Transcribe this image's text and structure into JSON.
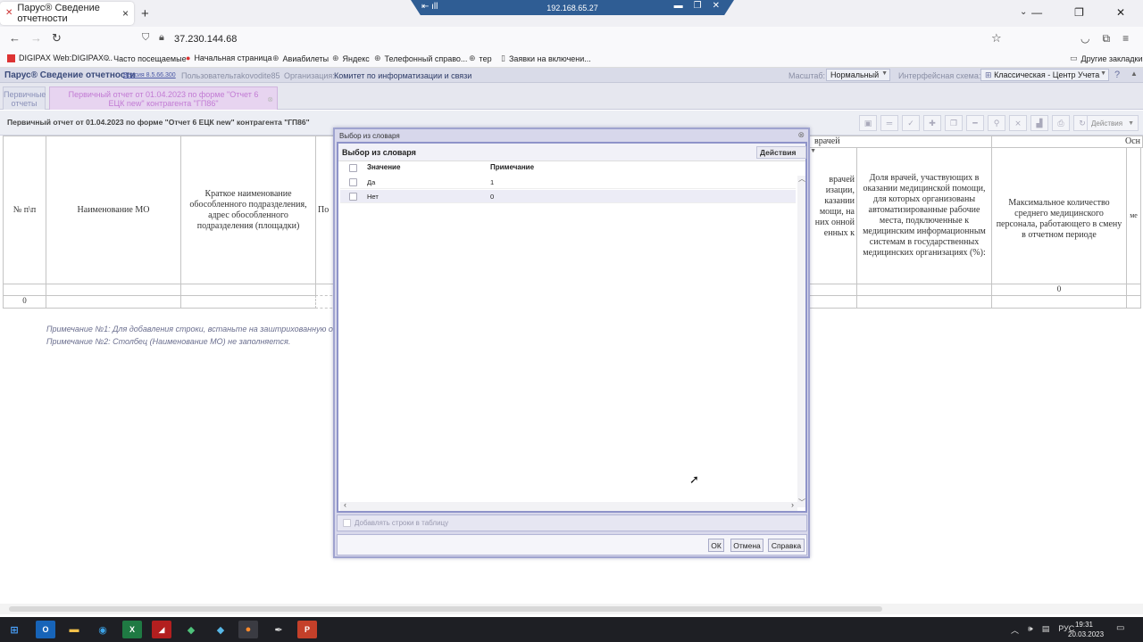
{
  "remote_bar": {
    "ip": "192.168.65.27"
  },
  "browser": {
    "tab_title": "Парус® Сведение отчетности",
    "url": "37.230.144.68",
    "bookmarks": [
      "DIGIPAX Web:DIGIPAX ...",
      "Часто посещаемые",
      "Начальная страница",
      "Авиабилеты",
      "Яндекс",
      "Телефонный справо...",
      "тер",
      "Заявки на включени..."
    ],
    "other_bookmarks": "Другие закладки"
  },
  "app": {
    "title": "Парус® Сведение отчетности",
    "version": "Версия 8.5.66.300",
    "user_label": "Пользователь:",
    "user_value": "rakovodite85",
    "org_label": "Организация:",
    "org_value": "Комитет по информатизации и связи",
    "scale_label": "Масштаб:",
    "scale_value": "Нормальный",
    "scheme_label": "Интерфейсная схема:",
    "scheme_value": "Классическая - Центр Учета"
  },
  "doc_tabs": [
    {
      "label": "Первичные отчеты"
    },
    {
      "label": "Первичный отчет от 01.04.2023 по форме \"Отчет 6 ЕЦК new\" контрагента \"ГП86\""
    }
  ],
  "report": {
    "title": "Первичный отчет от 01.04.2023 по форме \"Отчет 6 ЕЦК new\" контрагента \"ГП86\"",
    "actions": "Действия",
    "group_header_left": "врачей",
    "group_header_right": "Осн",
    "columns": {
      "num": "№ п\\п",
      "mo_name": "Наименование МО",
      "short_name": "Краткое наименование обособленного подразделения, адрес обособленного подразделения (площадки)",
      "partial": "По",
      "doctors_fragment": "врачей изации, казании мощи, на них онной енных к",
      "doctors_share": "Доля врачей, участвующих в оказании медицинской помощи, для которых организованы автоматизированные рабочие места, подключенные к медицинским информационным системам в государственных медицинских организациях (%):",
      "max_staff": "Максимальное количество среднего медицинского персонала, работающего в смену в отчетном периоде",
      "edge": "ме"
    },
    "row_index": "0",
    "max_staff_value": "0",
    "notes": [
      "Примечание №1: Для добавления строки, встаньте на заштрихованную о",
      "Примечание №2: Столбец (Наименование МО) не заполняется."
    ]
  },
  "modal": {
    "window_title": "Выбор из словаря",
    "title": "Выбор из словаря",
    "actions": "Действия",
    "col_value": "Значение",
    "col_note": "Примечание",
    "rows": [
      {
        "value": "Да",
        "note": "1"
      },
      {
        "value": "Нет",
        "note": "0"
      }
    ],
    "add_rows_label": "Добавлять строки в таблицу",
    "ok": "ОК",
    "cancel": "Отмена",
    "help": "Справка"
  },
  "taskbar": {
    "lang": "РУС",
    "time": "19:31",
    "date": "20.03.2023"
  }
}
